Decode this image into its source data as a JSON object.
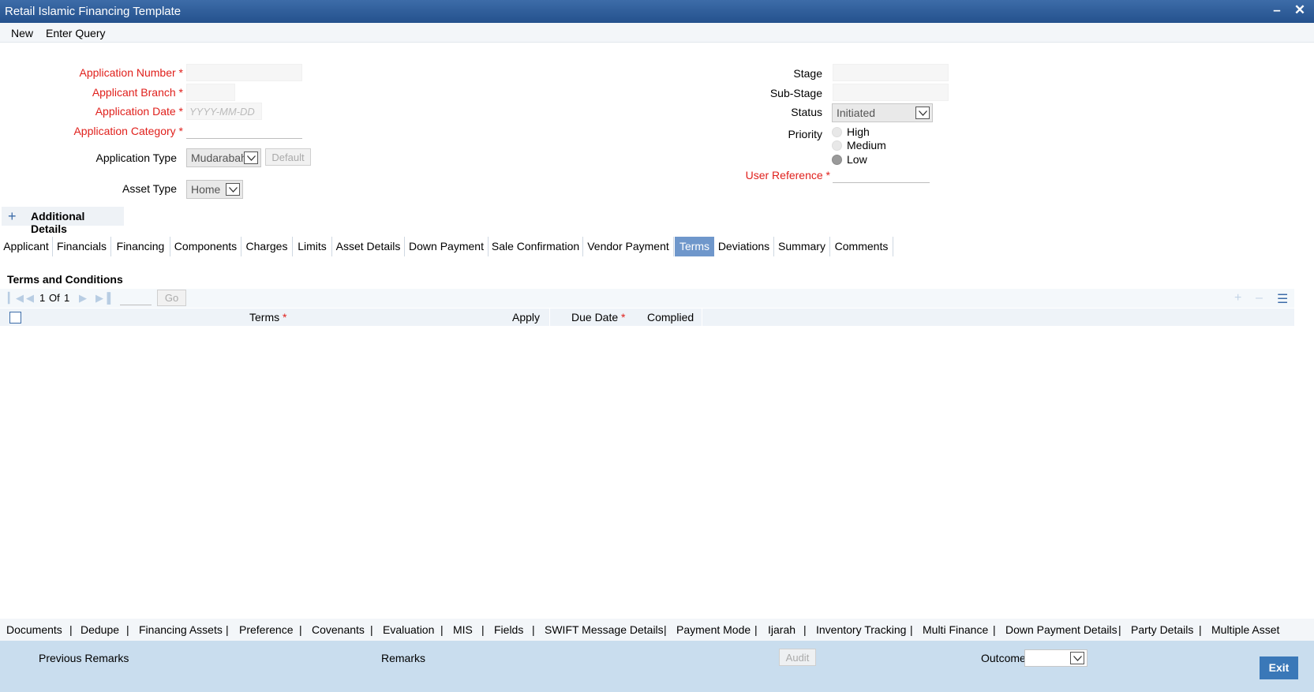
{
  "window": {
    "title": "Retail Islamic Financing Template",
    "minimize_icon": "minimize-icon",
    "close_icon": "close-icon"
  },
  "menu": {
    "new": "New",
    "enter_query": "Enter Query"
  },
  "form": {
    "application_number": {
      "label": "Application Number",
      "required": "*",
      "value": ""
    },
    "applicant_branch": {
      "label": "Applicant Branch",
      "required": "*",
      "value": ""
    },
    "application_date": {
      "label": "Application Date",
      "required": "*",
      "placeholder": "YYYY-MM-DD"
    },
    "application_category": {
      "label": "Application Category",
      "required": "*",
      "value": ""
    },
    "application_type": {
      "label": "Application Type",
      "value": "Mudarabah",
      "default_button": "Default"
    },
    "asset_type": {
      "label": "Asset Type",
      "value": "Home"
    },
    "stage": {
      "label": "Stage",
      "value": ""
    },
    "sub_stage": {
      "label": "Sub-Stage",
      "value": ""
    },
    "status": {
      "label": "Status",
      "value": "Initiated"
    },
    "priority": {
      "label": "Priority",
      "options": [
        "High",
        "Medium",
        "Low"
      ],
      "selected": "Low"
    },
    "user_reference": {
      "label": "User Reference",
      "required": "*",
      "value": ""
    }
  },
  "additional_details": {
    "label": "Additional Details",
    "icon": "plus-icon"
  },
  "tabs": [
    "Applicant",
    "Financials",
    "Financing",
    "Components",
    "Charges",
    "Limits",
    "Asset Details",
    "Down Payment",
    "Sale Confirmation",
    "Vendor Payment",
    "Terms",
    "Deviations",
    "Summary",
    "Comments"
  ],
  "active_tab": "Terms",
  "terms_section": {
    "title": "Terms and Conditions",
    "pager": {
      "current": "1",
      "of_label": "Of",
      "total": "1",
      "go_label": "Go"
    },
    "columns": {
      "terms": "Terms",
      "apply": "Apply",
      "due_date": "Due Date",
      "complied": "Complied",
      "required_mark": "*"
    }
  },
  "bottom_links": [
    "Documents",
    "Dedupe",
    "Financing Assets",
    "Preference",
    "Covenants",
    "Evaluation",
    "MIS",
    "Fields",
    "SWIFT Message Details",
    "Payment Mode",
    "Ijarah",
    "Inventory Tracking",
    "Multi Finance",
    "Down Payment Details",
    "Party Details",
    "Multiple Asset"
  ],
  "bottom_separator": "|",
  "footer": {
    "previous_remarks": "Previous Remarks",
    "remarks": "Remarks",
    "audit": "Audit",
    "outcome": "Outcome",
    "outcome_value": "",
    "exit": "Exit"
  },
  "colors": {
    "titlebar": "#2f5e9a",
    "active_tab": "#6f97cb",
    "required": "#e0201c",
    "footer": "#c9ddee",
    "exit_button": "#3a78b8"
  }
}
